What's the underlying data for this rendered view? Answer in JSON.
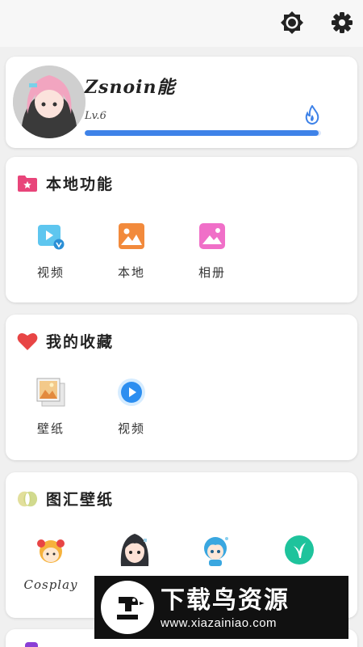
{
  "topbar": {
    "brightness_icon": "brightness-icon",
    "settings_icon": "gear-icon"
  },
  "profile": {
    "username": "Zsnoin能",
    "level": "Lv.6",
    "progress_fraction": 0.99,
    "progress_color": "#3e82e8"
  },
  "local": {
    "title": "本地功能",
    "items": [
      {
        "label": "视频",
        "icon": "video-icon"
      },
      {
        "label": "本地",
        "icon": "image-icon"
      },
      {
        "label": "相册",
        "icon": "album-icon"
      }
    ]
  },
  "favorites": {
    "title": "我的收藏",
    "items": [
      {
        "label": "壁纸",
        "icon": "wallpaper-icon"
      },
      {
        "label": "视频",
        "icon": "play-icon"
      }
    ]
  },
  "gallery": {
    "title": "图汇壁纸",
    "items": [
      {
        "label": "Cosplay",
        "icon": "cosplay-icon"
      },
      {
        "label": "",
        "icon": "anime-girl-icon"
      },
      {
        "label": "",
        "icon": "chibi-icon"
      },
      {
        "label": "",
        "icon": "leaf-icon"
      }
    ]
  },
  "watermark": {
    "title": "下载鸟资源",
    "url": "www.xiazainiao.com"
  }
}
